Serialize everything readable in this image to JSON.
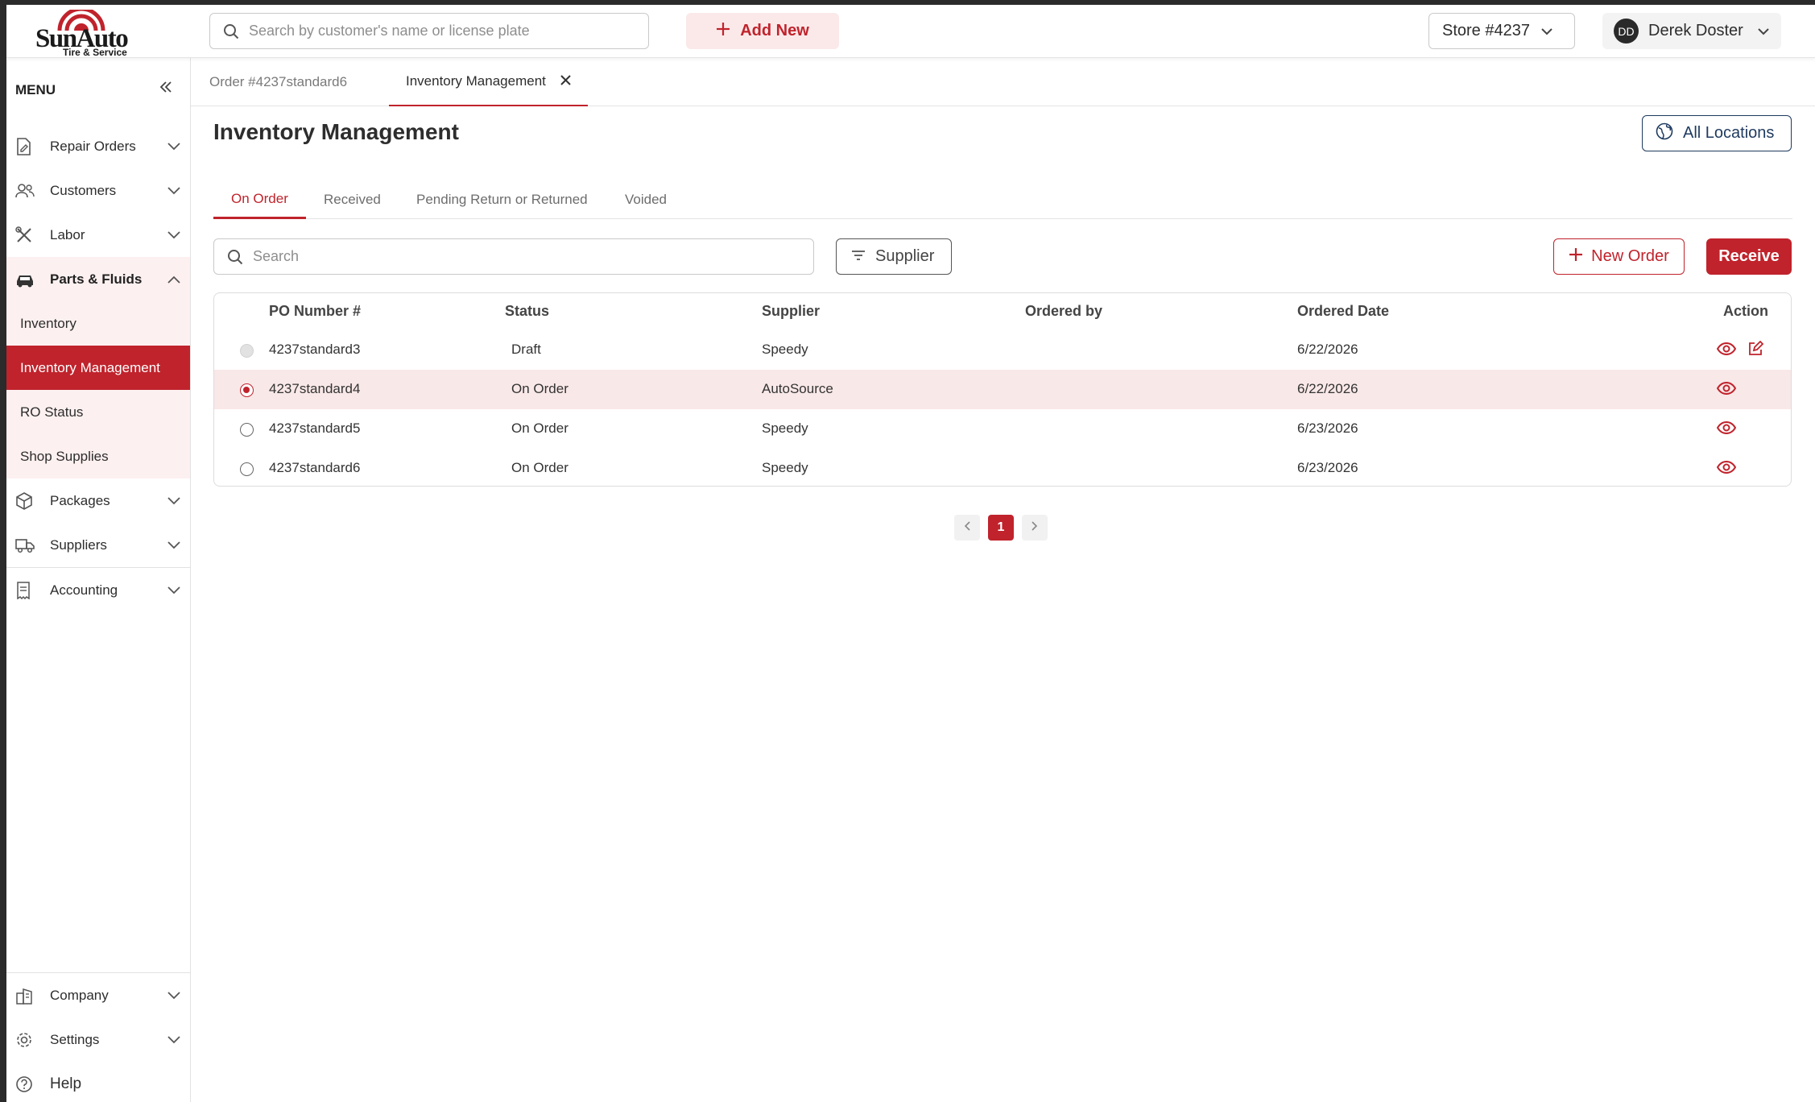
{
  "brand": {
    "name": "SunAuto",
    "tagline": "Tire & Service",
    "accent": "#c0232c"
  },
  "topbar": {
    "search_placeholder": "Search by customer's name or license plate",
    "add_new_label": "Add New",
    "store_label": "Store #4237",
    "user_initials": "DD",
    "user_name": "Derek Doster"
  },
  "sidebar": {
    "menu_label": "MENU",
    "items": [
      {
        "label": "Repair Orders",
        "icon": "repair-order-icon"
      },
      {
        "label": "Customers",
        "icon": "customers-icon"
      },
      {
        "label": "Labor",
        "icon": "tools-icon"
      },
      {
        "label": "Parts & Fluids",
        "icon": "car-icon",
        "expanded": true
      },
      {
        "label": "Packages",
        "icon": "package-icon"
      },
      {
        "label": "Suppliers",
        "icon": "truck-icon"
      },
      {
        "label": "Accounting",
        "icon": "receipt-icon"
      }
    ],
    "sub_items": [
      {
        "label": "Inventory"
      },
      {
        "label": "Inventory Management",
        "active": true
      },
      {
        "label": "RO Status"
      },
      {
        "label": "Shop Supplies"
      }
    ],
    "bottom_items": [
      {
        "label": "Company",
        "icon": "building-icon"
      },
      {
        "label": "Settings",
        "icon": "gear-icon"
      },
      {
        "label": "Help",
        "icon": "help-icon"
      }
    ]
  },
  "doc_tabs": [
    {
      "label": "Order #4237standard6"
    },
    {
      "label": "Inventory Management",
      "active": true
    }
  ],
  "page": {
    "title": "Inventory Management",
    "all_locations_label": "All Locations",
    "tabs": [
      {
        "label": "On Order",
        "active": true
      },
      {
        "label": "Received"
      },
      {
        "label": "Pending Return or Returned"
      },
      {
        "label": "Voided"
      }
    ],
    "search_placeholder": "Search",
    "supplier_filter_label": "Supplier",
    "new_order_label": "New Order",
    "receive_label": "Receive"
  },
  "table": {
    "columns": [
      "PO Number #",
      "Status",
      "Supplier",
      "Ordered by",
      "Ordered Date",
      "Action"
    ],
    "rows": [
      {
        "po": "4237standard3",
        "status": "Draft",
        "supplier": "Speedy",
        "ordered_by": "",
        "date": "6/22/2026",
        "radio": "disabled",
        "editable": true
      },
      {
        "po": "4237standard4",
        "status": "On Order",
        "supplier": "AutoSource",
        "ordered_by": "",
        "date": "6/22/2026",
        "radio": "checked",
        "editable": false
      },
      {
        "po": "4237standard5",
        "status": "On Order",
        "supplier": "Speedy",
        "ordered_by": "",
        "date": "6/23/2026",
        "radio": "empty",
        "editable": false
      },
      {
        "po": "4237standard6",
        "status": "On Order",
        "supplier": "Speedy",
        "ordered_by": "",
        "date": "6/23/2026",
        "radio": "empty",
        "editable": false
      }
    ]
  },
  "pagination": {
    "current_page": "1"
  }
}
